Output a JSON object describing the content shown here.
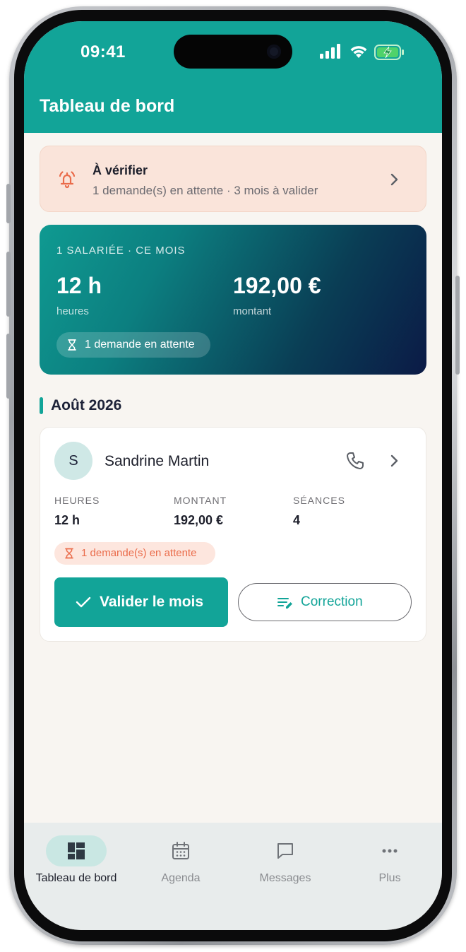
{
  "status_bar": {
    "time": "09:41"
  },
  "header": {
    "title": "Tableau de bord"
  },
  "alert": {
    "title": "À vérifier",
    "subtitle": "1 demande(s) en attente · 3 mois à valider"
  },
  "summary": {
    "caption": "1 SALARIÉE · CE MOIS",
    "hours_value": "12 h",
    "hours_label": "heures",
    "amount_value": "192,00 €",
    "amount_label": "montant",
    "pending": "1 demande en attente"
  },
  "section": {
    "title": "Août 2026"
  },
  "employee": {
    "initial": "S",
    "name": "Sandrine Martin",
    "stats": [
      {
        "label": "HEURES",
        "value": "12 h"
      },
      {
        "label": "MONTANT",
        "value": "192,00 €"
      },
      {
        "label": "SÉANCES",
        "value": "4"
      }
    ],
    "pending": "1 demande(s) en attente",
    "validate_label": "Valider le mois",
    "correction_label": "Correction"
  },
  "tabs": [
    {
      "label": "Tableau de bord",
      "icon": "dashboard-icon",
      "active": true
    },
    {
      "label": "Agenda",
      "icon": "calendar-icon",
      "active": false
    },
    {
      "label": "Messages",
      "icon": "message-icon",
      "active": false
    },
    {
      "label": "Plus",
      "icon": "more-icon",
      "active": false
    }
  ],
  "colors": {
    "brand": "#12a498",
    "alert_bg": "#fae4da",
    "alert_accent": "#ea6c4b",
    "background": "#f8f5f1",
    "tab_bar": "#e8ecec"
  }
}
